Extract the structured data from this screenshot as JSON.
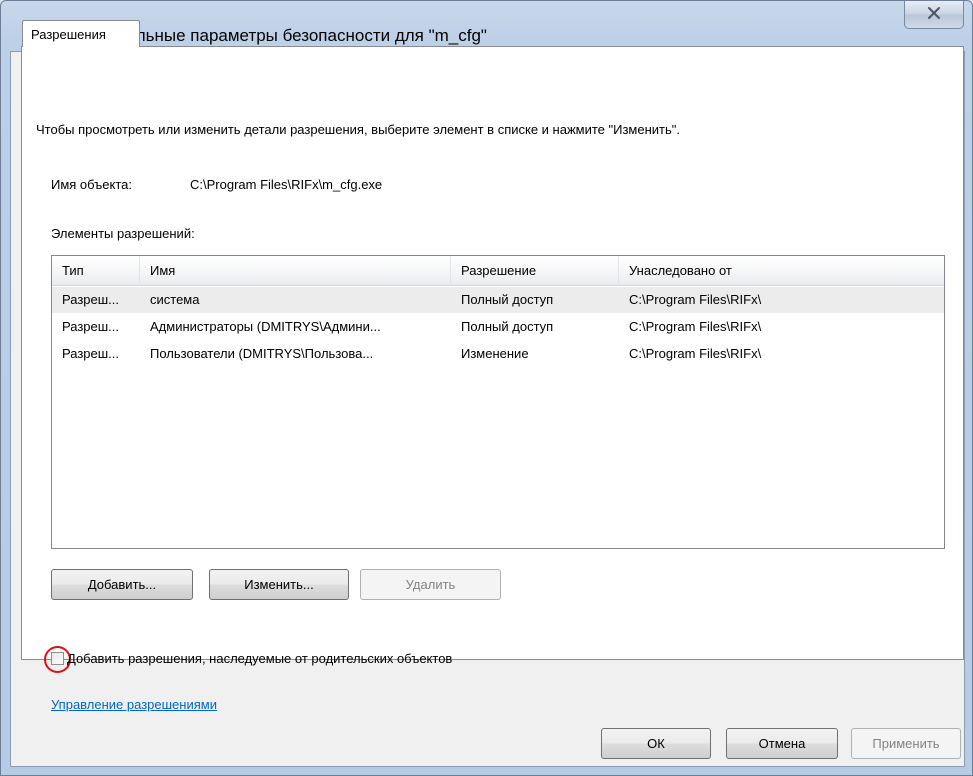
{
  "window": {
    "title": "Дополнительные параметры безопасности  для \"m_cfg\"",
    "close_glyph": "X",
    "title_icon": "folder-icon",
    "close_icon": "close-icon"
  },
  "tabs": [
    {
      "label": "Разрешения"
    }
  ],
  "panel": {
    "intro": "Чтобы просмотреть или изменить детали разрешения, выберите элемент в списке и нажмите \"Изменить\".",
    "object_name_label": "Имя объекта:",
    "object_name_value": "C:\\Program Files\\RIFx\\m_cfg.exe",
    "entries_label": "Элементы разрешений:"
  },
  "table": {
    "columns": [
      "Тип",
      "Имя",
      "Разрешение",
      "Унаследовано от"
    ],
    "rows": [
      {
        "type": "Разреш...",
        "name": "система",
        "permission": "Полный доступ",
        "inherited": "C:\\Program Files\\RIFx\\"
      },
      {
        "type": "Разреш...",
        "name": "Администраторы (DMITRYS\\Админи...",
        "permission": "Полный доступ",
        "inherited": "C:\\Program Files\\RIFx\\"
      },
      {
        "type": "Разреш...",
        "name": "Пользователи (DMITRYS\\Пользова...",
        "permission": "Изменение",
        "inherited": "C:\\Program Files\\RIFx\\"
      }
    ],
    "selected_row": 0
  },
  "buttons": {
    "add": "Добавить...",
    "edit": "Изменить...",
    "remove": "Удалить"
  },
  "inherit_checkbox": {
    "label": "Добавить разрешения, наследуемые от родительских объектов",
    "checked": false
  },
  "manage_link": "Управление разрешениями",
  "footer": {
    "ok": "ОК",
    "cancel": "Отмена",
    "apply": "Применить"
  },
  "colors": {
    "link": "#0066cc",
    "highlight_ring": "#e01010",
    "selected_row": "#ececec"
  }
}
